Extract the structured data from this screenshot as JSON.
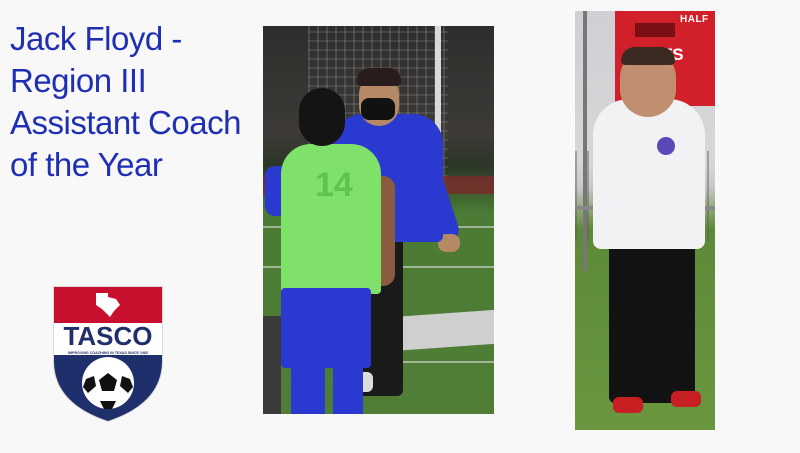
{
  "slide": {
    "title": "Jack Floyd -\nRegion III\nAssistant Coach\nof the Year"
  },
  "photo1": {
    "jersey_number": "14"
  },
  "photo2": {
    "scoreboard_half": "HALF",
    "scoreboard_shots": "SHOTS"
  },
  "logo": {
    "name": "TASCO",
    "tagline": "IMPROVING COACHING IN TEXAS SINCE 1983",
    "colors": {
      "red": "#c8102e",
      "blue": "#1f2f6b",
      "white": "#ffffff"
    }
  },
  "colors": {
    "title": "#1f2fb3",
    "background": "#f8f8f8"
  }
}
